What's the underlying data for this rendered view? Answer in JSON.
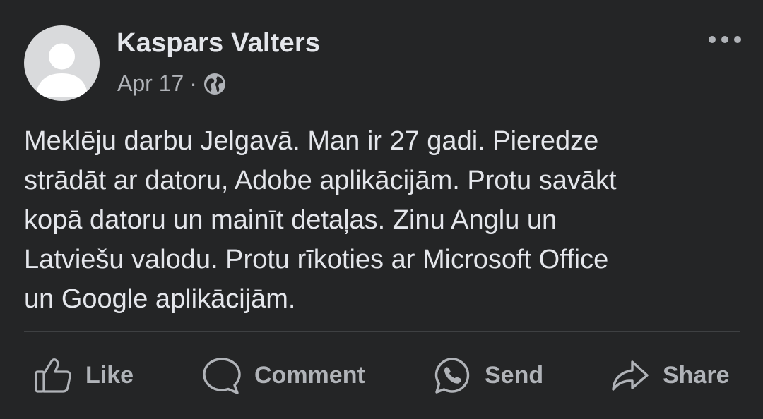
{
  "post": {
    "author": "Kaspars Valters",
    "date": "Apr 17",
    "separator": "·",
    "privacy_icon": "globe-icon",
    "text_lines": [
      "Meklēju darbu Jelgavā. Man ir 27 gadi. Pieredze",
      "strādāt ar datoru, Adobe aplikācijām. Protu savākt",
      "kopā datoru un mainīt detaļas. Zinu Anglu un",
      "Latviešu valodu. Protu rīkoties ar Microsoft Office",
      "un Google aplikācijām."
    ]
  },
  "actions": {
    "like": "Like",
    "comment": "Comment",
    "send": "Send",
    "share": "Share"
  },
  "colors": {
    "background": "#242526",
    "primary_text": "#e4e6eb",
    "secondary_text": "#b0b3b8"
  }
}
